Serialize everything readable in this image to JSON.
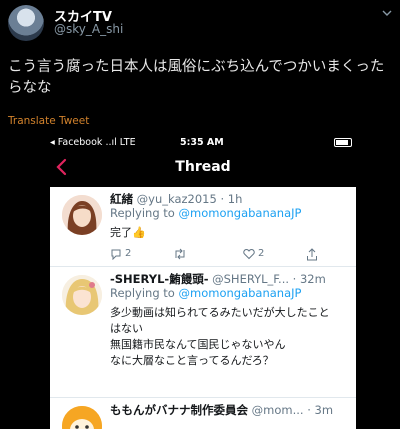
{
  "outer": {
    "name": "スカイTV",
    "handle": "@sky_A_shi",
    "text": "こう言う腐った日本人は風俗にぶち込んでつかいまくったらなな",
    "translate": "Translate Tweet"
  },
  "phone": {
    "carrier": "◂ Facebook ..ıl LTE",
    "time": "5:35 AM",
    "title": "Thread"
  },
  "replies": [
    {
      "name": "紅緒",
      "meta": "@yu_kaz2015 · 1h",
      "replying_prefix": "Replying to ",
      "replying_handle": "@momongabananaJP",
      "lines": [
        "完了👍"
      ],
      "reply_count": "2",
      "retweet_count": "",
      "like_count": "2"
    },
    {
      "name": "-SHERYL-鮪饅頭-",
      "meta": "@SHERYL_F... · 32m",
      "replying_prefix": "Replying to ",
      "replying_handle": "@momongabananaJP",
      "lines": [
        "多少動画は知られてるみたいだが大したこと",
        "はない",
        "無国籍市民なんて国民じゃないやん",
        "なに大層なこと言ってるんだろ？"
      ]
    },
    {
      "name": "ももんがバナナ制作委員会",
      "meta": "@mom... · 3m"
    }
  ],
  "colors": {
    "translate": "#d2822c",
    "link": "#1da1f2",
    "muted": "#657786"
  }
}
